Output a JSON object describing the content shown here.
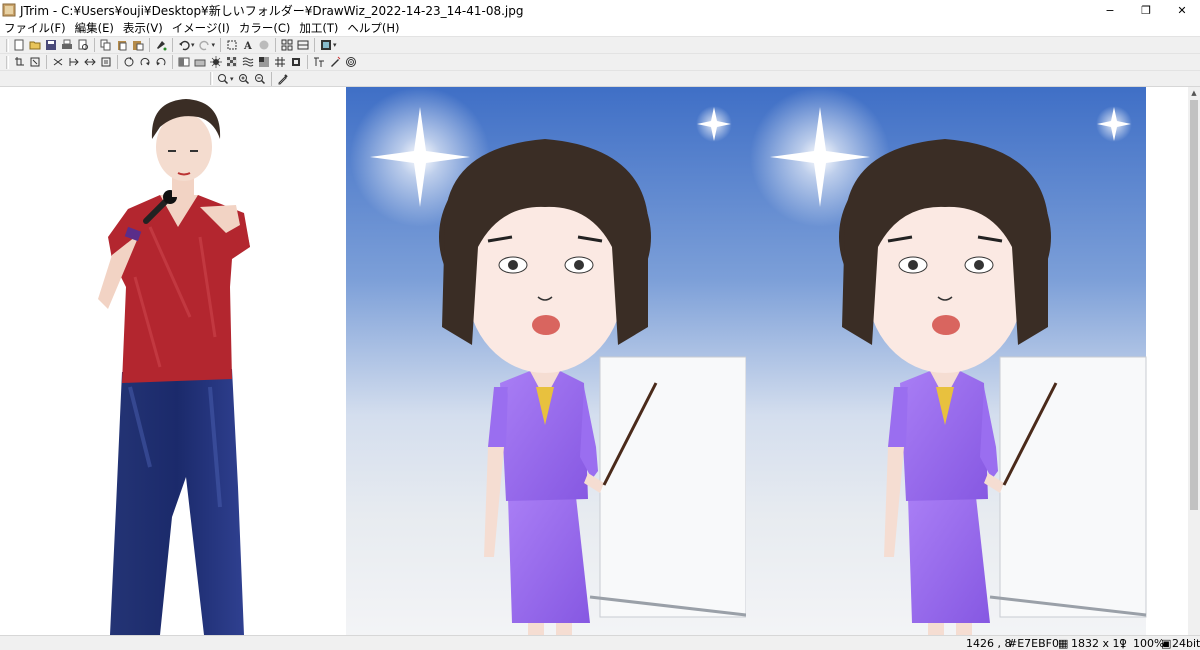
{
  "window": {
    "title": "JTrim - C:¥Users¥ouji¥Desktop¥新しいフォルダー¥DrawWiz_2022-14-23_14-41-08.jpg",
    "controls": [
      "−",
      "❐",
      "✕"
    ]
  },
  "menu": [
    "ファイル(F)",
    "編集(E)",
    "表示(V)",
    "イメージ(I)",
    "カラー(C)",
    "加工(T)",
    "ヘルプ(H)"
  ],
  "toolbar_icons": {
    "row1": [
      "new-icon",
      "open-icon",
      "save-icon",
      "print-icon",
      "print-preview-icon",
      "copy-icon",
      "paste-icon",
      "paste-new-icon",
      "paint-icon",
      "undo-icon",
      "redo-icon",
      "crop-icon",
      "text-icon",
      "circle-icon",
      "grid-icon",
      "border-icon",
      "view-mode-icon"
    ],
    "row2": [
      "rotate-icon",
      "flip-icon",
      "mirror-icon",
      "resize-icon",
      "trim-icon",
      "rotate-left-icon",
      "rotate-right-icon",
      "rotate-free-icon",
      "brightness-icon",
      "contrast-icon",
      "sharpen-icon",
      "noise-icon",
      "mosaic-icon",
      "emboss-icon",
      "gradation-icon",
      "frame-icon",
      "blur-icon",
      "color-tone-icon",
      "spiral-icon"
    ],
    "row3": [
      "zoom-menu-icon",
      "zoom-in-icon",
      "zoom-out-icon",
      "eyedropper-icon"
    ]
  },
  "colors": {
    "sky_top": "#3f6fc6",
    "sky_bottom": "#e7ebf0",
    "uniform": "#9a6ef0",
    "shirt": "#b3262f",
    "jeans": "#1b2a6b",
    "hair": "#3a2d25"
  },
  "status": {
    "coords": "1426 , 8",
    "color": "#E7EBF0",
    "size": "1832 x 11",
    "zoom": "100%",
    "depth": "24bit"
  }
}
